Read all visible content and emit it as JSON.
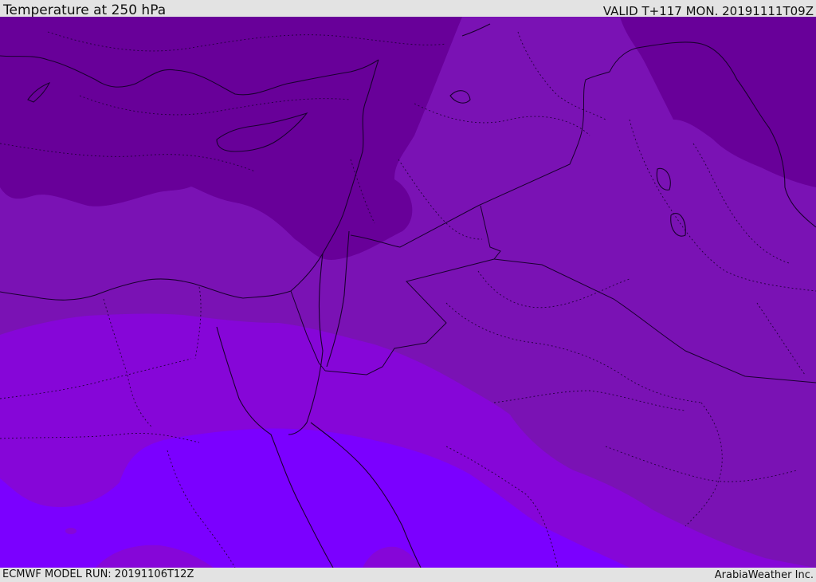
{
  "header": {
    "title": "Temperature at 250 hPa",
    "valid_time": "VALID T+117 MON. 20191111T09Z"
  },
  "footer": {
    "model_run": "ECMWF MODEL RUN: 20191106T12Z",
    "credit": "ArabiaWeather Inc."
  },
  "map": {
    "colors": {
      "darkest_band": "#680099",
      "dark_band": "#7a12b4",
      "mid_band": "#8606d8",
      "bright_band": "#7b00ff",
      "coastline": "#1a0030"
    }
  }
}
